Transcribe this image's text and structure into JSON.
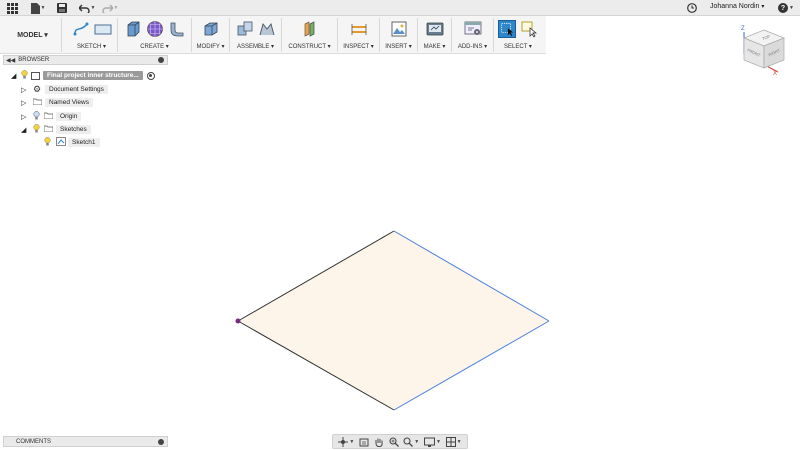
{
  "topbar": {
    "user_name": "Johanna Nordin",
    "help_label": "?",
    "user_caret": "▾"
  },
  "toolbar": {
    "mode_label": "MODEL ▾",
    "groups": [
      {
        "label": "SKETCH ▾"
      },
      {
        "label": "CREATE ▾"
      },
      {
        "label": "MODIFY ▾"
      },
      {
        "label": "ASSEMBLE ▾"
      },
      {
        "label": "CONSTRUCT ▾"
      },
      {
        "label": "INSPECT ▾"
      },
      {
        "label": "INSERT ▾"
      },
      {
        "label": "MAKE ▾"
      },
      {
        "label": "ADD-INS ▾"
      },
      {
        "label": "SELECT ▾"
      }
    ]
  },
  "browser": {
    "title": "BROWSER",
    "items": [
      {
        "label": "Final project inner structure..."
      },
      {
        "label": "Document Settings"
      },
      {
        "label": "Named Views"
      },
      {
        "label": "Origin"
      },
      {
        "label": "Sketches"
      },
      {
        "label": "Sketch1"
      }
    ]
  },
  "comments": {
    "title": "COMMENTS"
  },
  "viewcube": {
    "faces": [
      "FRONT",
      "RIGHT",
      "TOP"
    ],
    "axes": [
      "Z",
      "X"
    ]
  },
  "colors": {
    "accent": "#2f86c9",
    "sketch_fill": "#fdf4ea",
    "edge_blue": "#4a7de0",
    "edge_dark": "#333333",
    "origin_point": "#7a2a7a"
  }
}
